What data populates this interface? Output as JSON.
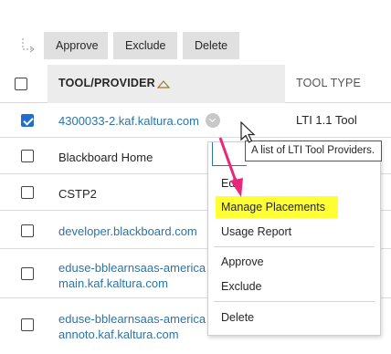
{
  "toolbar": {
    "approve": "Approve",
    "exclude": "Exclude",
    "delete": "Delete"
  },
  "table": {
    "col_provider": "TOOL/PROVIDER",
    "col_type": "TOOL TYPE",
    "rows": [
      {
        "name": "4300033-2.kaf.kaltura.com",
        "type": "LTI 1.1 Tool",
        "checked": true,
        "link": true
      },
      {
        "name": "Blackboard Home",
        "type": "",
        "checked": false,
        "link": false
      },
      {
        "name": "CSTP2",
        "type": "",
        "checked": false,
        "link": false
      },
      {
        "name": "developer.blackboard.com",
        "type": "",
        "checked": false,
        "link": true
      },
      {
        "name_line1": "eduse-bblearnsaas-america",
        "name_line2": "main.kaf.kaltura.com",
        "type": "",
        "checked": false,
        "link": true
      },
      {
        "name_line1": "eduse-bblearnsaas-america",
        "name_line2": "annoto.kaf.kaltura.com",
        "type": "",
        "checked": false,
        "link": true
      }
    ]
  },
  "tooltip": "A list of LTI Tool Providers.",
  "menu": {
    "edit": "Edit",
    "manage_placements": "Manage Placements",
    "usage_report": "Usage Report",
    "approve": "Approve",
    "exclude": "Exclude",
    "delete": "Delete"
  },
  "colors": {
    "link": "#2a74a8",
    "highlight": "#ffff33",
    "arrow": "#e8277a",
    "checkbox": "#1f6fd1"
  },
  "icons": [
    "move-arrow-icon",
    "sort-ascending-icon",
    "chevron-down-icon",
    "mouse-cursor-icon",
    "annotation-arrow-icon"
  ]
}
